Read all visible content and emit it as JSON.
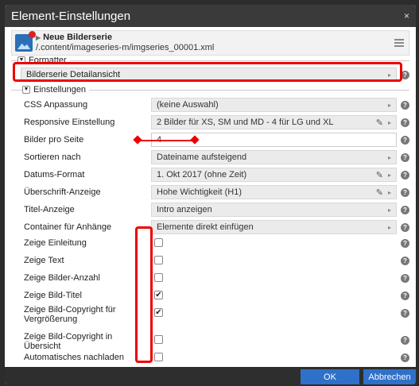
{
  "window": {
    "title": "Element-Einstellungen",
    "close": "×"
  },
  "resource": {
    "name": "Neue Bilderserie",
    "path": "/.content/imageseries-m/imgseries_00001.xml"
  },
  "formatter": {
    "heading": "Formatter",
    "toggle": "▼",
    "value": "Bilderserie Detailansicht"
  },
  "settings": {
    "heading": "Einstellungen",
    "toggle": "▼",
    "rows": [
      {
        "label": "CSS Anpassung",
        "value": "(keine Auswahl)"
      },
      {
        "label": "Responsive Einstellung",
        "value": "2 Bilder für XS, SM und MD - 4 für LG und XL"
      },
      {
        "label": "Bilder pro Seite",
        "value": "4"
      },
      {
        "label": "Sortieren nach",
        "value": "Dateiname aufsteigend"
      },
      {
        "label": "Datums-Format",
        "value": "1. Okt 2017 (ohne Zeit)"
      },
      {
        "label": "Überschrift-Anzeige",
        "value": "Hohe Wichtigkeit (H1)"
      },
      {
        "label": "Titel-Anzeige",
        "value": "Intro anzeigen"
      },
      {
        "label": "Container für Anhänge",
        "value": "Elemente direkt einfügen"
      },
      {
        "label": "Zeige Einleitung",
        "checked": false
      },
      {
        "label": "Zeige Text",
        "checked": false
      },
      {
        "label": "Zeige Bilder-Anzahl",
        "checked": false
      },
      {
        "label": "Zeige Bild-Titel",
        "checked": true
      },
      {
        "label": "Zeige Bild-Copyright für Vergrößerung",
        "checked": true
      },
      {
        "label": "Zeige Bild-Copyright in Übersicht",
        "checked": false
      },
      {
        "label": "Automatisches nachladen",
        "checked": false
      }
    ]
  },
  "glyphs": {
    "help": "?",
    "arrow": "▸",
    "check": "✔",
    "pencil": "✎",
    "tri": "▶"
  },
  "buttons": {
    "ok": "OK",
    "cancel": "Abbrechen"
  },
  "colors": {
    "accent": "#2f70c9",
    "highlight": "#e00000",
    "titlebar": "#3a3a3a"
  }
}
